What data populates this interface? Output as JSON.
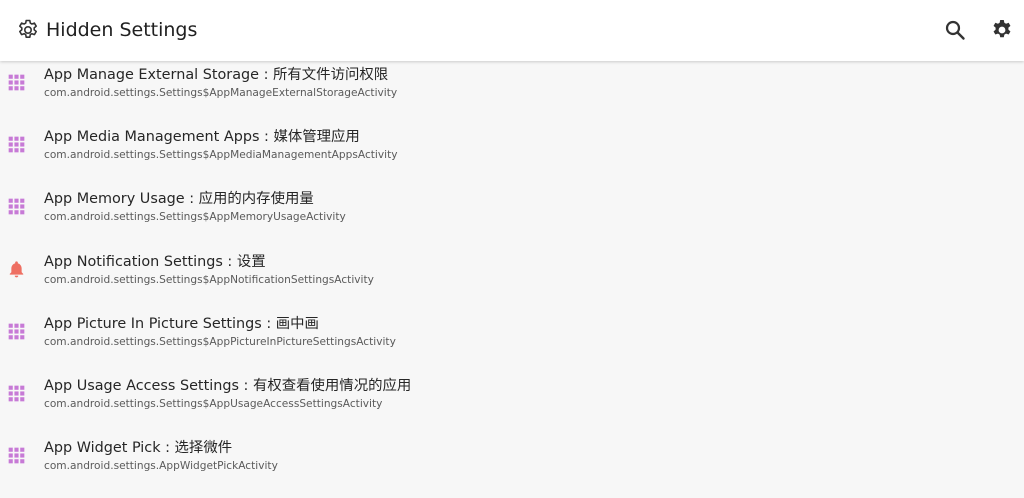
{
  "appbar": {
    "title": "Hidden Settings",
    "app_icon": "gear-outline-icon",
    "actions": [
      {
        "name": "search",
        "icon": "search-icon"
      },
      {
        "name": "settings",
        "icon": "gear-icon"
      }
    ]
  },
  "colors": {
    "grid_icon": "#c77ad6",
    "bell_icon": "#ee6f62",
    "appbar_bg": "#ffffff",
    "list_bg": "#f7f7f7"
  },
  "items": [
    {
      "icon": "apps-grid-icon",
      "title": "App Manage External Storage : 所有文件访问权限",
      "subtitle": "com.android.settings.Settings$AppManageExternalStorageActivity"
    },
    {
      "icon": "apps-grid-icon",
      "title": "App Media Management Apps : 媒体管理应用",
      "subtitle": "com.android.settings.Settings$AppMediaManagementAppsActivity"
    },
    {
      "icon": "apps-grid-icon",
      "title": "App Memory Usage : 应用的内存使用量",
      "subtitle": "com.android.settings.Settings$AppMemoryUsageActivity"
    },
    {
      "icon": "bell-icon",
      "title": "App Notification Settings : 设置",
      "subtitle": "com.android.settings.Settings$AppNotificationSettingsActivity"
    },
    {
      "icon": "apps-grid-icon",
      "title": "App Picture In Picture Settings : 画中画",
      "subtitle": "com.android.settings.Settings$AppPictureInPictureSettingsActivity"
    },
    {
      "icon": "apps-grid-icon",
      "title": "App Usage Access Settings : 有权查看使用情况的应用",
      "subtitle": "com.android.settings.Settings$AppUsageAccessSettingsActivity"
    },
    {
      "icon": "apps-grid-icon",
      "title": "App Widget Pick : 选择微件",
      "subtitle": "com.android.settings.AppWidgetPickActivity"
    }
  ]
}
